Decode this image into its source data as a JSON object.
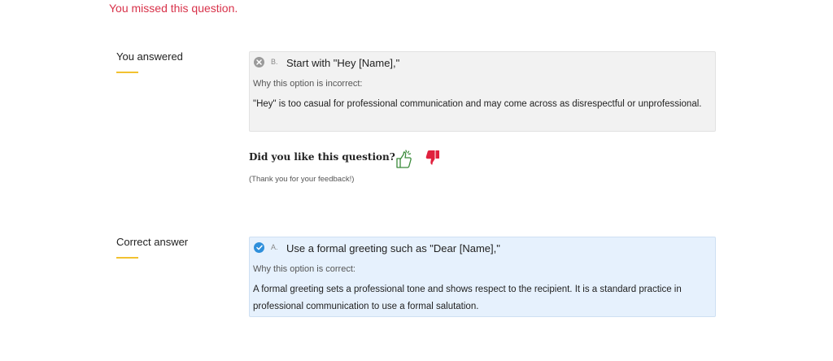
{
  "status_message": "You missed this question.",
  "your_answer": {
    "section_label": "You answered",
    "letter": "B.",
    "option_text": "Start with \"Hey [Name],\"",
    "why_label": "Why this option is incorrect:",
    "explanation": "\"Hey\" is too casual for professional communication and may come across as disrespectful or unprofessional.",
    "status_icon": "x-circle-icon"
  },
  "feedback": {
    "question": "Did you like this question?",
    "thanks": "(Thank you for your feedback!)",
    "like_icon": "thumbs-up-icon",
    "dislike_icon": "thumbs-down-icon",
    "like_color": "#3a8a3a",
    "dislike_color": "#e0213e"
  },
  "correct_answer": {
    "section_label": "Correct answer",
    "letter": "A.",
    "option_text": "Use a formal greeting such as \"Dear [Name],\"",
    "why_label": "Why this option is correct:",
    "explanation": "A formal greeting sets a professional tone and shows respect to the recipient. It is a standard practice in professional communication to use a formal salutation.",
    "status_icon": "check-circle-icon"
  },
  "colors": {
    "error": "#d8324a",
    "accent_underline": "#f2c230",
    "correct_bg": "#e6f1fd",
    "incorrect_bg": "#f2f2f2"
  }
}
